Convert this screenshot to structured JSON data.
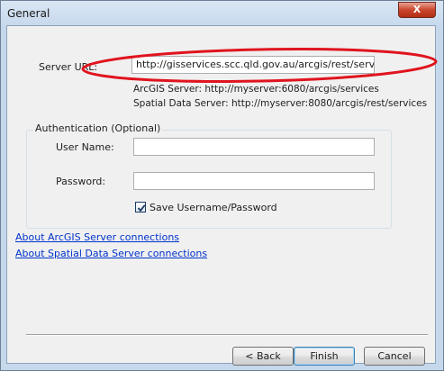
{
  "window": {
    "title": "General",
    "close_glyph": "X"
  },
  "server": {
    "label": "Server URL:",
    "value": "http://gisservices.scc.qld.gov.au/arcgis/rest/services/",
    "hint_arcgis": "ArcGIS Server: http://myserver:6080/arcgis/services",
    "hint_spatial": "Spatial Data Server: http://myserver:8080/arcgis/rest/services"
  },
  "auth": {
    "group_title": "Authentication (Optional)",
    "username_label": "User Name:",
    "username_value": "",
    "password_label": "Password:",
    "password_value": "",
    "save_label": "Save Username/Password",
    "save_checked": true
  },
  "links": {
    "about_arcgis": "About ArcGIS Server connections",
    "about_spatial": "About Spatial Data Server connections"
  },
  "buttons": {
    "back": "< Back",
    "finish": "Finish",
    "cancel": "Cancel"
  },
  "colors": {
    "highlight_ellipse": "#e0141e",
    "link": "#0033cc"
  }
}
